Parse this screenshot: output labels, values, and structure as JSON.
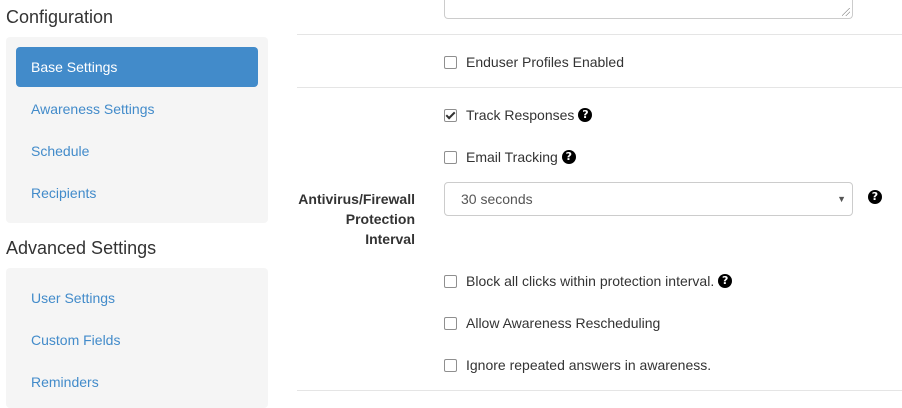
{
  "sidebar": {
    "configuration_title": "Configuration",
    "configuration_items": [
      {
        "label": "Base Settings",
        "active": true
      },
      {
        "label": "Awareness Settings",
        "active": false
      },
      {
        "label": "Schedule",
        "active": false
      },
      {
        "label": "Recipients",
        "active": false
      }
    ],
    "advanced_title": "Advanced Settings",
    "advanced_items": [
      {
        "label": "User Settings"
      },
      {
        "label": "Custom Fields"
      },
      {
        "label": "Reminders"
      }
    ]
  },
  "form": {
    "enduser_profiles": {
      "label": "Enduser Profiles Enabled",
      "checked": false
    },
    "track_responses": {
      "label": "Track Responses",
      "checked": true,
      "help_icon": "question-circle-icon"
    },
    "email_tracking": {
      "label": "Email Tracking",
      "checked": false,
      "help_icon": "question-circle-icon"
    },
    "protection_interval": {
      "label": "Antivirus/Firewall Protection Interval",
      "label_lines": [
        "Antivirus/Firewall",
        "Protection",
        "Interval"
      ],
      "value": "30 seconds"
    },
    "block_clicks": {
      "label": "Block all clicks within protection interval.",
      "checked": false
    },
    "allow_rescheduling": {
      "label": "Allow Awareness Rescheduling",
      "checked": false
    },
    "ignore_repeated": {
      "label": "Ignore repeated answers in awareness.",
      "checked": false
    }
  },
  "colors": {
    "accent": "#428bca",
    "well_background": "#f5f5f5",
    "divider": "#e5e5e5"
  }
}
